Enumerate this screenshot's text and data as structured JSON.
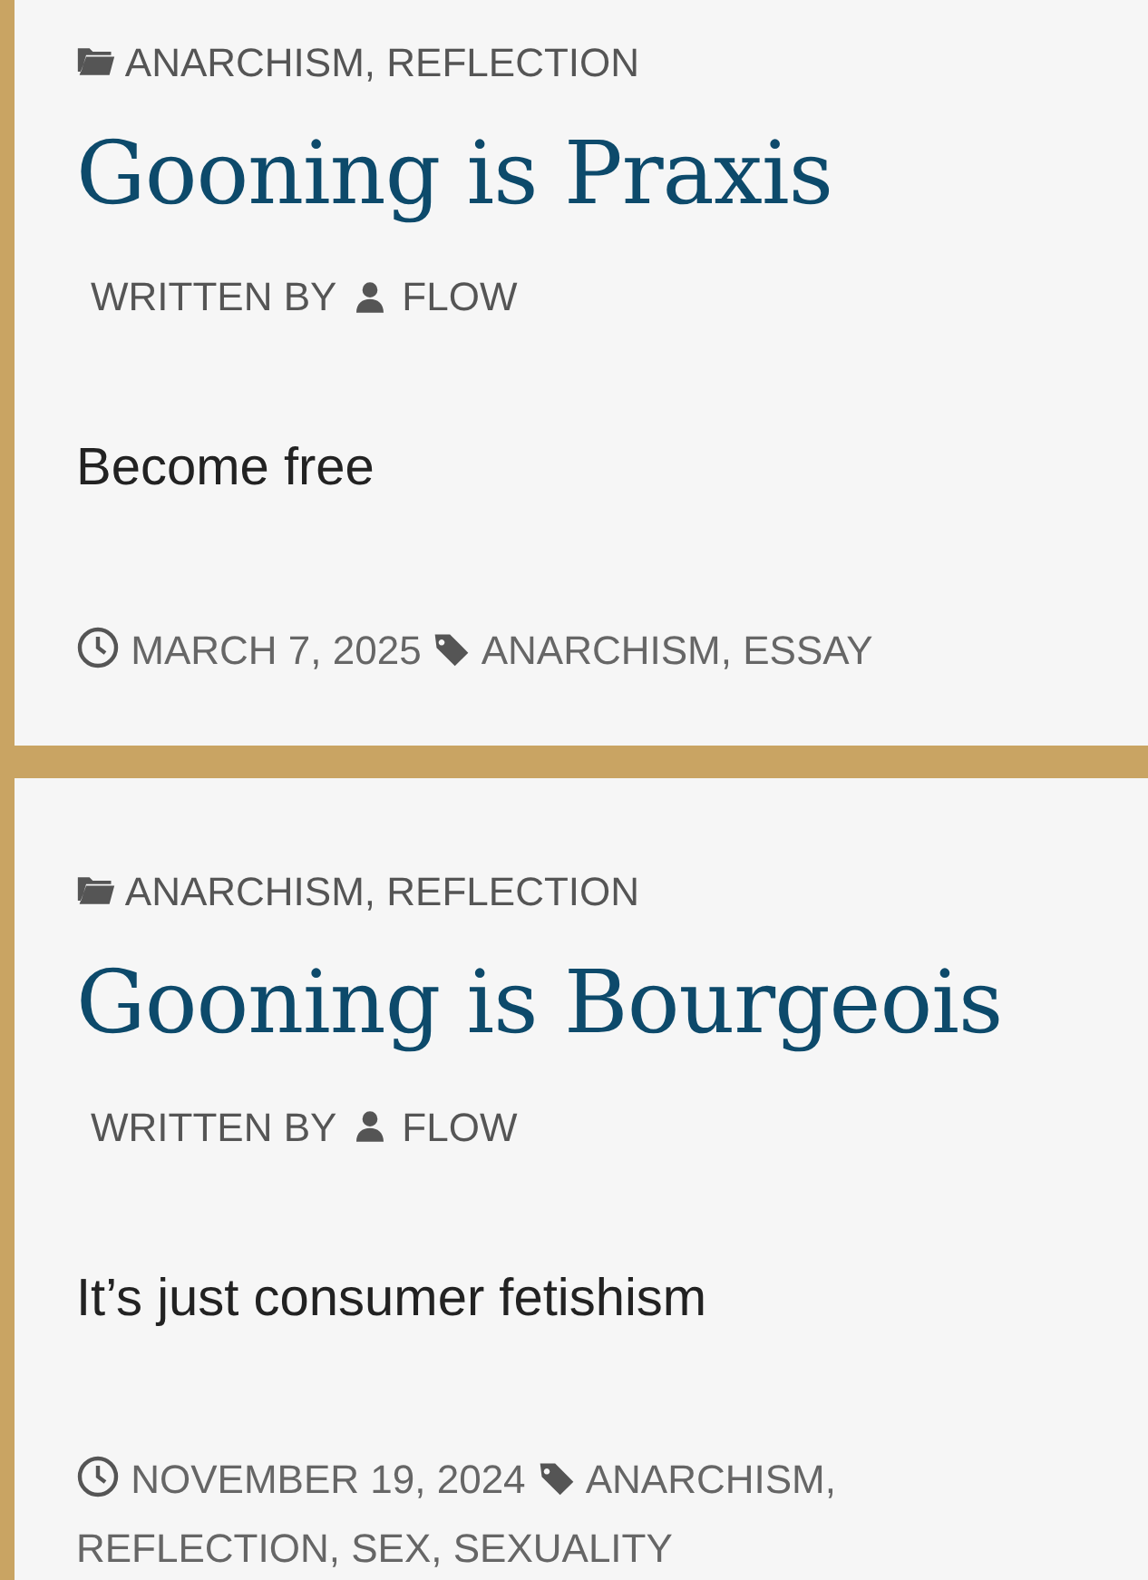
{
  "posts": [
    {
      "categories": [
        "ANARCHISM,",
        "REFLECTION"
      ],
      "title": "Gooning is Praxis",
      "author_label": "WRITTEN BY",
      "author": "FLOW",
      "excerpt": "Become free",
      "date": "MARCH 7, 2025",
      "tags": [
        "ANARCHISM,",
        "ESSAY"
      ]
    },
    {
      "categories": [
        "ANARCHISM,",
        "REFLECTION"
      ],
      "title": "Gooning is Bourgeois",
      "author_label": "WRITTEN BY",
      "author": "FLOW",
      "excerpt": "It’s just consumer fetishism",
      "date": "NOVEMBER 19, 2024",
      "tags": [
        "ANARCHISM,",
        "REFLECTION,",
        "SEX,",
        "SEXUALITY"
      ]
    }
  ]
}
